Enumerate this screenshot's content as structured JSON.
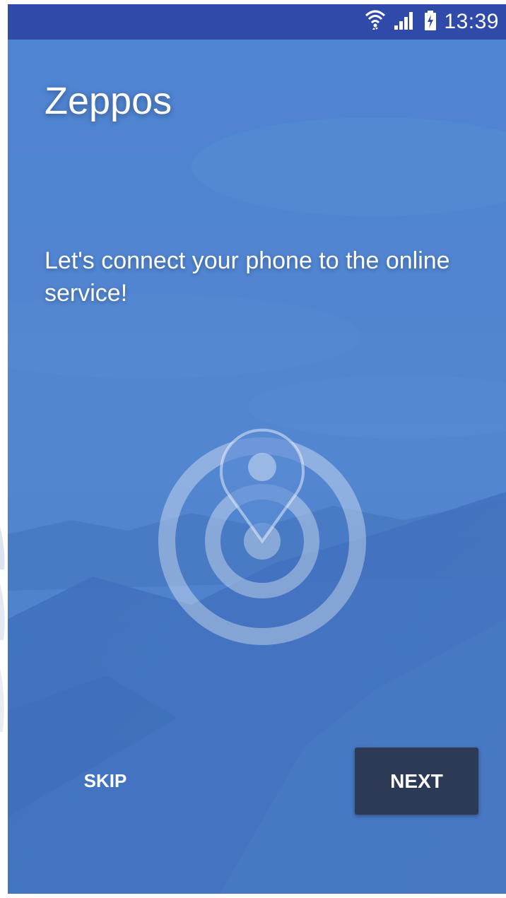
{
  "status_bar": {
    "time": "13:39",
    "icons": [
      "wifi-icon",
      "signal-icon",
      "battery-charging-icon"
    ],
    "background": "#2f4aa8"
  },
  "app": {
    "title": "Zeppos"
  },
  "onboarding": {
    "message": "Let's connect your phone to the online service!",
    "hero_icon": "location-target-icon"
  },
  "actions": {
    "skip_label": "SKIP",
    "next_label": "NEXT"
  },
  "colors": {
    "background_blue": "#4a7bc8",
    "next_button": "#2c3a55",
    "text": "#ffffff"
  }
}
